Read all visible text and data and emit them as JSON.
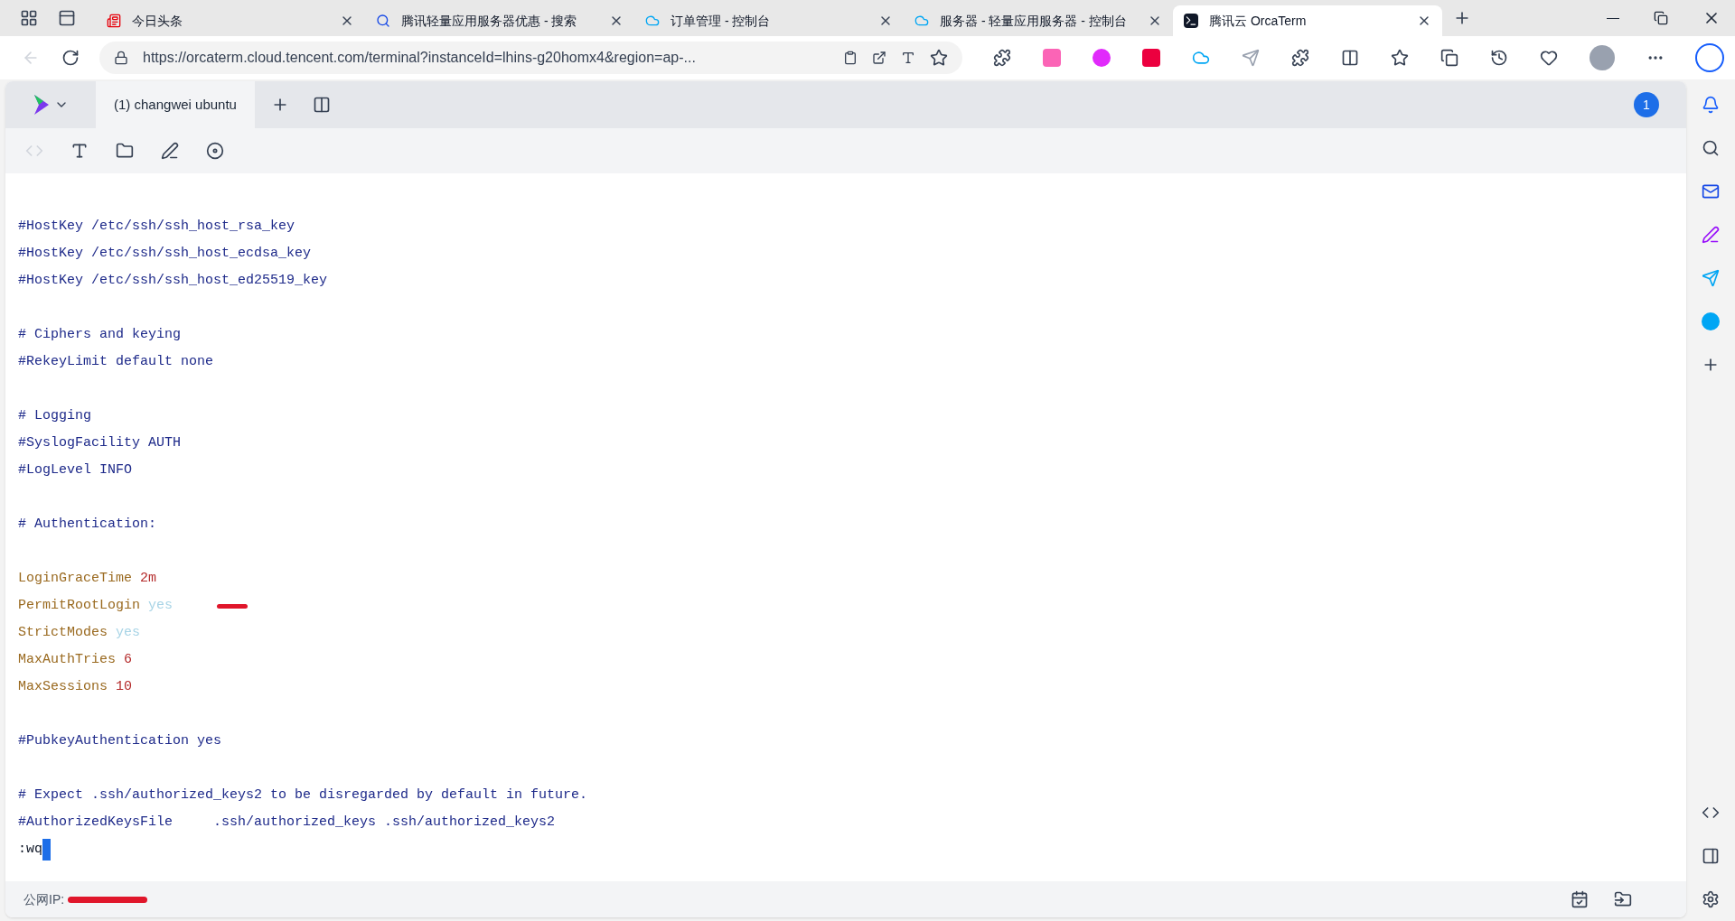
{
  "browser": {
    "tabs": [
      {
        "title": "今日头条",
        "kind": "news",
        "selected": false
      },
      {
        "title": "腾讯轻量应用服务器优惠 - 搜索",
        "kind": "search",
        "selected": false
      },
      {
        "title": "订单管理 - 控制台",
        "kind": "cloud",
        "selected": false
      },
      {
        "title": "服务器 - 轻量应用服务器 - 控制台",
        "kind": "cloud",
        "selected": false
      },
      {
        "title": "腾讯云 OrcaTerm",
        "kind": "terminal",
        "selected": true
      }
    ],
    "url": "https://orcaterm.cloud.tencent.com/terminal?instanceId=lhins-g20homx4&region=ap-..."
  },
  "terminal_app": {
    "session_tabs": [
      {
        "label": "(1) changwei ubuntu",
        "selected": true
      }
    ],
    "notification_count": "1",
    "lines": [
      {
        "kind": "blank"
      },
      {
        "kind": "comment",
        "text": "#HostKey /etc/ssh/ssh_host_rsa_key"
      },
      {
        "kind": "comment",
        "text": "#HostKey /etc/ssh/ssh_host_ecdsa_key"
      },
      {
        "kind": "comment",
        "text": "#HostKey /etc/ssh/ssh_host_ed25519_key"
      },
      {
        "kind": "blank"
      },
      {
        "kind": "comment",
        "text": "# Ciphers and keying"
      },
      {
        "kind": "comment",
        "text": "#RekeyLimit default none"
      },
      {
        "kind": "blank"
      },
      {
        "kind": "comment",
        "text": "# Logging"
      },
      {
        "kind": "comment",
        "text": "#SyslogFacility AUTH"
      },
      {
        "kind": "comment",
        "text": "#LogLevel INFO"
      },
      {
        "kind": "blank"
      },
      {
        "kind": "comment",
        "text": "# Authentication:"
      },
      {
        "kind": "blank"
      },
      {
        "kind": "setting",
        "key": "LoginGraceTime",
        "value": {
          "text": "2m",
          "color": "#b42a2a"
        },
        "redacted": false
      },
      {
        "kind": "setting",
        "key": "PermitRootLogin",
        "value": {
          "text": "yes",
          "color": "#a8d4e6"
        },
        "redacted": true
      },
      {
        "kind": "setting",
        "key": "StrictModes",
        "value": {
          "text": "yes",
          "color": "#a8d4e6"
        },
        "redacted": false
      },
      {
        "kind": "setting",
        "key": "MaxAuthTries",
        "value": {
          "text": "6",
          "color": "#b42a2a"
        },
        "redacted": false
      },
      {
        "kind": "setting",
        "key": "MaxSessions",
        "value": {
          "text": "10",
          "color": "#b42a2a"
        },
        "redacted": false
      },
      {
        "kind": "blank"
      },
      {
        "kind": "comment",
        "text": "#PubkeyAuthentication yes"
      },
      {
        "kind": "blank"
      },
      {
        "kind": "comment",
        "text": "# Expect .ssh/authorized_keys2 to be disregarded by default in future."
      },
      {
        "kind": "comment",
        "text": "#AuthorizedKeysFile     .ssh/authorized_keys .ssh/authorized_keys2"
      },
      {
        "kind": "command",
        "text": ":wq"
      }
    ],
    "status_bar": {
      "label": "公网IP:"
    }
  }
}
